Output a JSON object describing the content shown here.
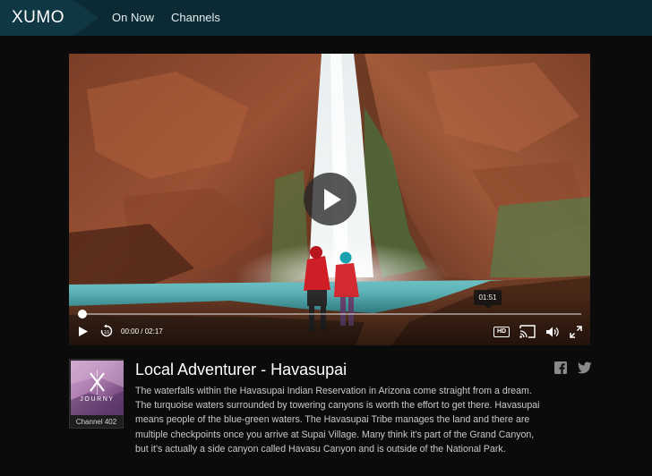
{
  "header": {
    "logo": "XUMO",
    "nav": [
      {
        "label": "On Now"
      },
      {
        "label": "Channels"
      }
    ]
  },
  "player": {
    "hover_time": "01:51",
    "current_time": "00:00",
    "time_separator": " / ",
    "duration": "02:17",
    "progress": 0.0,
    "hd_label": "HD"
  },
  "channel": {
    "brand": "JOURNY",
    "number_label": "Channel 402"
  },
  "video": {
    "title": "Local Adventurer - Havasupai",
    "description": "The waterfalls within the Havasupai Indian Reservation in Arizona come straight from a dream. The turquoise waters surrounded by towering canyons is worth the effort to get there. Havasupai means people of the blue-green waters. The Havasupai Tribe manages the land and there are multiple checkpoints once you arrive at Supai Village. Many think it's part of the Grand Canyon, but it's actually a side canyon called Havasu Canyon and is outside of the National Park."
  },
  "colors": {
    "header_bg": "#0c2a33",
    "logo_bg": "#0f3844",
    "page_bg": "#0b0b0b"
  },
  "icons": [
    "play-icon",
    "replay-10-icon",
    "hd-icon",
    "cast-icon",
    "volume-icon",
    "fullscreen-icon",
    "facebook-icon",
    "twitter-icon"
  ]
}
